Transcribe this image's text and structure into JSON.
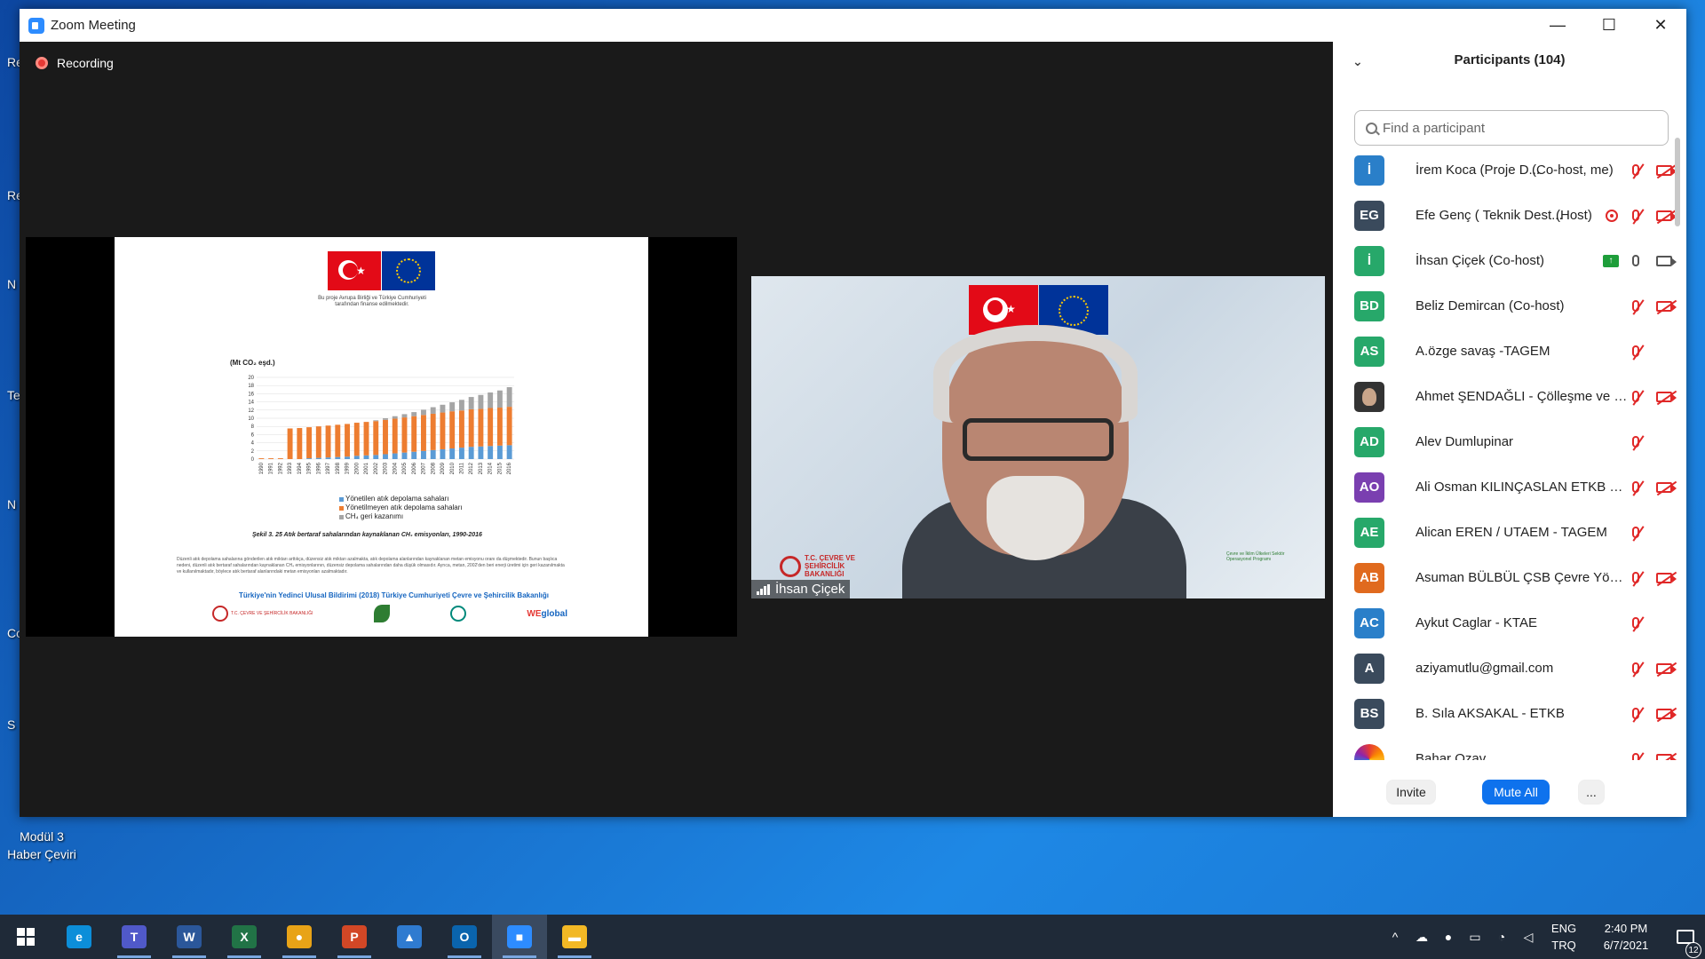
{
  "window": {
    "title": "Zoom Meeting",
    "minimize": "—",
    "maximize": "☐",
    "close": "✕"
  },
  "recording": {
    "label": "Recording"
  },
  "shared_slide": {
    "eu_note": "Bu proje Avrupa Birliği ve Türkiye Cumhuriyeti tarafından finanse edilmektedir.",
    "caption": "Şekil 3. 25 Atık bertaraf sahalarından kaynaklanan CH₄ emisyonları, 1990-2016",
    "body_text": "Düzenli atık depolama sahalarına gönderilen atık miktarı arttıkça, düzensiz atık miktarı azalmakta, atık depolama alanlarından kaynaklanan metan emisyonu oranı da düşmektedir. Bunun başlıca nedeni, düzenli atık bertaraf sahalarından kaynaklanan CH₄ emisyonlarının, düzensiz depolama sahalarından daha düşük olmasıdır. Ayrıca, metan, 2002'den beri enerji üretimi için geri kazanılmakta ve kullanılmaktadır, böylece atık bertaraf alanlarındaki metan emisyonları azalmaktadır.",
    "source": "Türkiye'nin Yedinci Ulusal Bildirimi (2018) Türkiye Cumhuriyeti Çevre ve Şehircilik Bakanlığı",
    "logo_ministry": "T.C. ÇEVRE VE ŞEHİRCİLİK BAKANLIĞI",
    "logo_we_prefix": "WE",
    "logo_we_suffix": "global"
  },
  "chart_data": {
    "type": "bar",
    "stacked": true,
    "unit_label": "(Mt CO₂ eşd.)",
    "ylim": [
      0,
      20
    ],
    "yticks": [
      0,
      2,
      4,
      6,
      8,
      10,
      12,
      14,
      16,
      18,
      20
    ],
    "categories": [
      "1990",
      "1991",
      "1992",
      "1993",
      "1994",
      "1995",
      "1996",
      "1997",
      "1998",
      "1999",
      "2000",
      "2001",
      "2002",
      "2003",
      "2004",
      "2005",
      "2006",
      "2007",
      "2008",
      "2009",
      "2010",
      "2011",
      "2012",
      "2013",
      "2014",
      "2015",
      "2016"
    ],
    "series": [
      {
        "name": "Yönetilen atık depolama sahaları",
        "color": "#5b9bd5",
        "values": [
          0,
          0,
          0,
          0,
          0,
          0.2,
          0.3,
          0.4,
          0.5,
          0.6,
          0.8,
          0.9,
          1.0,
          1.2,
          1.4,
          1.6,
          1.8,
          2.0,
          2.2,
          2.4,
          2.6,
          2.8,
          3.0,
          3.1,
          3.2,
          3.3,
          3.4
        ]
      },
      {
        "name": "Yönetilmeyen atık depolama sahaları",
        "color": "#ed7d31",
        "values": [
          0.2,
          0.2,
          0.2,
          7.5,
          7.6,
          7.6,
          7.7,
          7.8,
          7.9,
          8.0,
          8.1,
          8.2,
          8.3,
          8.4,
          8.5,
          8.6,
          8.7,
          8.8,
          8.9,
          9.0,
          9.1,
          9.1,
          9.2,
          9.2,
          9.3,
          9.3,
          9.4
        ]
      },
      {
        "name": "CH₄ geri kazanımı",
        "color": "#a5a5a5",
        "values": [
          0,
          0,
          0,
          0,
          0,
          0,
          0,
          0,
          0,
          0,
          0,
          0,
          0.2,
          0.4,
          0.6,
          0.8,
          1.0,
          1.3,
          1.6,
          1.9,
          2.2,
          2.6,
          3.0,
          3.4,
          3.8,
          4.2,
          4.8
        ]
      }
    ]
  },
  "speaker": {
    "name": "İhsan Çiçek",
    "bg_logo_left": "T.C. ÇEVRE VE ŞEHİRCİLİK BAKANLIĞI",
    "bg_logo_right": "Çevre ve İklim Ülkeleri Sektör Operasyonel Programı"
  },
  "participants": {
    "title": "Participants (104)",
    "search_placeholder": "Find a participant",
    "list": [
      {
        "initials": "İ",
        "color": "#2a7fc9",
        "name": "İrem Koca (Proje D...",
        "role": "(Co-host, me)",
        "mic": "muted",
        "cam": "off"
      },
      {
        "initials": "EG",
        "color": "#3a4a5c",
        "name": "Efe Genç ( Teknik Dest...",
        "role": "(Host)",
        "mic": "muted",
        "cam": "off",
        "recording": true
      },
      {
        "initials": "İ",
        "color": "#27a86a",
        "name": "İhsan Çiçek (Co-host)",
        "role": "",
        "mic": "on",
        "cam": "on",
        "sharing": true
      },
      {
        "initials": "BD",
        "color": "#27a86a",
        "name": "Beliz Demircan (Co-host)",
        "role": "",
        "mic": "muted",
        "cam": "off"
      },
      {
        "initials": "AS",
        "color": "#27a86a",
        "name": "A.özge savaş -TAGEM",
        "role": "",
        "mic": "muted",
        "cam": "none"
      },
      {
        "initials": "",
        "color": "#444",
        "name": "Ahmet ŞENDAĞLI - Çölleşme ve E...",
        "role": "",
        "mic": "muted",
        "cam": "off",
        "photo": true
      },
      {
        "initials": "AD",
        "color": "#27a86a",
        "name": "Alev Dumlupinar",
        "role": "",
        "mic": "muted",
        "cam": "none"
      },
      {
        "initials": "AO",
        "color": "#7a3fb0",
        "name": "Ali Osman KILINÇASLAN ETKB Uz...",
        "role": "",
        "mic": "muted",
        "cam": "off"
      },
      {
        "initials": "AE",
        "color": "#27a86a",
        "name": "Alican EREN / UTAEM - TAGEM",
        "role": "",
        "mic": "muted",
        "cam": "none"
      },
      {
        "initials": "AB",
        "color": "#e06a1e",
        "name": "Asuman BÜLBÜL ÇSB Çevre Yöne...",
        "role": "",
        "mic": "muted",
        "cam": "off"
      },
      {
        "initials": "AC",
        "color": "#2a7fc9",
        "name": "Aykut Caglar - KTAE",
        "role": "",
        "mic": "muted",
        "cam": "none"
      },
      {
        "initials": "A",
        "color": "#3a4a5c",
        "name": "aziyamutlu@gmail.com",
        "role": "",
        "mic": "muted",
        "cam": "off"
      },
      {
        "initials": "BS",
        "color": "#3a4a5c",
        "name": "B. Sıla AKSAKAL - ETKB",
        "role": "",
        "mic": "muted",
        "cam": "off"
      },
      {
        "initials": "",
        "color": "#fff",
        "name": "Bahar Ozav",
        "role": "",
        "mic": "muted",
        "cam": "off",
        "rainbow": true
      }
    ],
    "invite": "Invite",
    "mute_all": "Mute All",
    "more": "..."
  },
  "desktop": {
    "icon_label_1": "Modül 3",
    "icon_label_2": "Haber Çeviri",
    "edge_labels": [
      "Re",
      "Re",
      "N",
      "Te",
      "N",
      "Co",
      "S"
    ]
  },
  "taskbar": {
    "apps": [
      {
        "name": "edge",
        "glyph": "e",
        "color": "#0c8ed9"
      },
      {
        "name": "teams",
        "glyph": "T",
        "color": "#5059c9"
      },
      {
        "name": "word",
        "glyph": "W",
        "color": "#2b579a"
      },
      {
        "name": "excel",
        "glyph": "X",
        "color": "#217346"
      },
      {
        "name": "chrome",
        "glyph": "●",
        "color": "#e8a317"
      },
      {
        "name": "powerpoint",
        "glyph": "P",
        "color": "#d24726"
      },
      {
        "name": "photos",
        "glyph": "▲",
        "color": "#2f7bd0"
      },
      {
        "name": "outlook",
        "glyph": "O",
        "color": "#0a64ad"
      },
      {
        "name": "zoom",
        "glyph": "■",
        "color": "#2d8cff"
      },
      {
        "name": "explorer",
        "glyph": "▬",
        "color": "#f2b825"
      }
    ],
    "lang_top": "ENG",
    "lang_bottom": "TRQ",
    "time": "2:40 PM",
    "date": "6/7/2021",
    "notifications": "12"
  }
}
